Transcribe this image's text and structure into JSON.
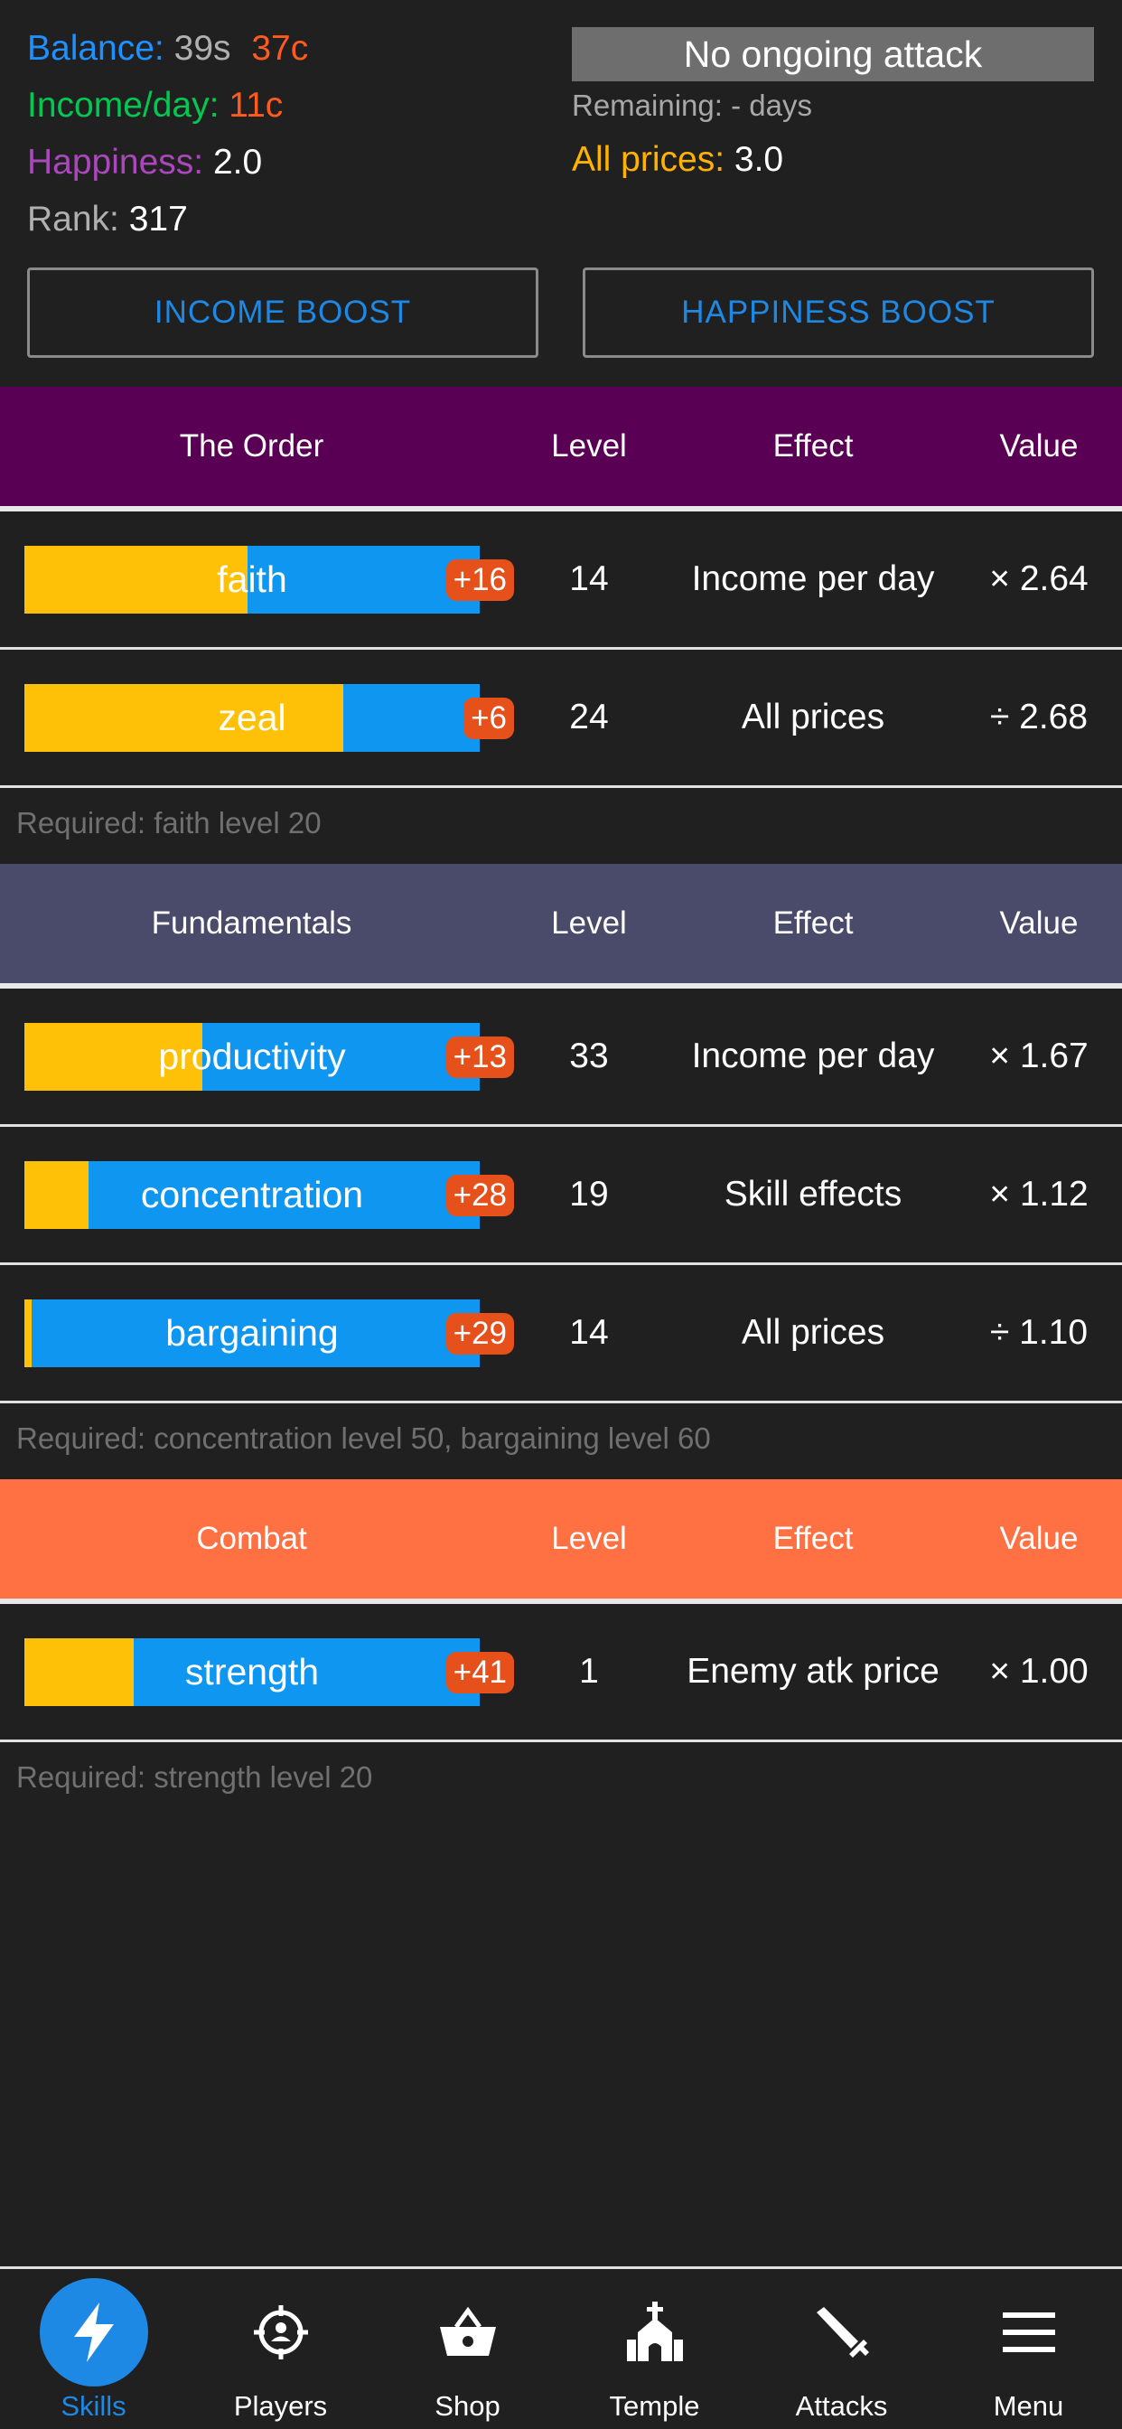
{
  "stats": {
    "balance_label": "Balance:",
    "balance_silver": "39s",
    "balance_copper": "37c",
    "income_label": "Income/day:",
    "income_value": "11c",
    "happiness_label": "Happiness:",
    "happiness_value": "2.0",
    "rank_label": "Rank:",
    "rank_value": "317"
  },
  "attack": {
    "status": "No ongoing attack",
    "remaining": "Remaining: - days",
    "prices_label": "All prices:",
    "prices_value": "3.0"
  },
  "buttons": {
    "income_boost": "INCOME BOOST",
    "happiness_boost": "HAPPINESS BOOST"
  },
  "columns": {
    "level": "Level",
    "effect": "Effect",
    "value": "Value"
  },
  "sections": [
    {
      "name": "The Order",
      "color": "#5a0054",
      "skills": [
        {
          "name": "faith",
          "progress": 0.49,
          "badge": "+16",
          "level": "14",
          "effect": "Income per day",
          "value": "× 2.64"
        },
        {
          "name": "zeal",
          "progress": 0.7,
          "badge": "+6",
          "level": "24",
          "effect": "All prices",
          "value": "÷ 2.68"
        }
      ],
      "required": "Required: faith level 20"
    },
    {
      "name": "Fundamentals",
      "color": "#4a4a6a",
      "skills": [
        {
          "name": "productivity",
          "progress": 0.39,
          "badge": "+13",
          "level": "33",
          "effect": "Income per day",
          "value": "× 1.67"
        },
        {
          "name": "concentration",
          "progress": 0.14,
          "badge": "+28",
          "level": "19",
          "effect": "Skill effects",
          "value": "× 1.12"
        },
        {
          "name": "bargaining",
          "progress": 0.015,
          "badge": "+29",
          "level": "14",
          "effect": "All prices",
          "value": "÷ 1.10"
        }
      ],
      "required": "Required: concentration level 50, bargaining level 60"
    },
    {
      "name": "Combat",
      "color": "#ff7043",
      "skills": [
        {
          "name": "strength",
          "progress": 0.24,
          "badge": "+41",
          "level": "1",
          "effect": "Enemy atk price",
          "value": "× 1.00"
        }
      ],
      "required": "Required: strength level 20"
    }
  ],
  "nav": [
    {
      "label": "Skills",
      "icon": "bolt-icon",
      "active": true
    },
    {
      "label": "Players",
      "icon": "crosshair-icon",
      "active": false
    },
    {
      "label": "Shop",
      "icon": "basket-icon",
      "active": false
    },
    {
      "label": "Temple",
      "icon": "church-icon",
      "active": false
    },
    {
      "label": "Attacks",
      "icon": "sword-icon",
      "active": false
    },
    {
      "label": "Menu",
      "icon": "menu-icon",
      "active": false
    }
  ]
}
